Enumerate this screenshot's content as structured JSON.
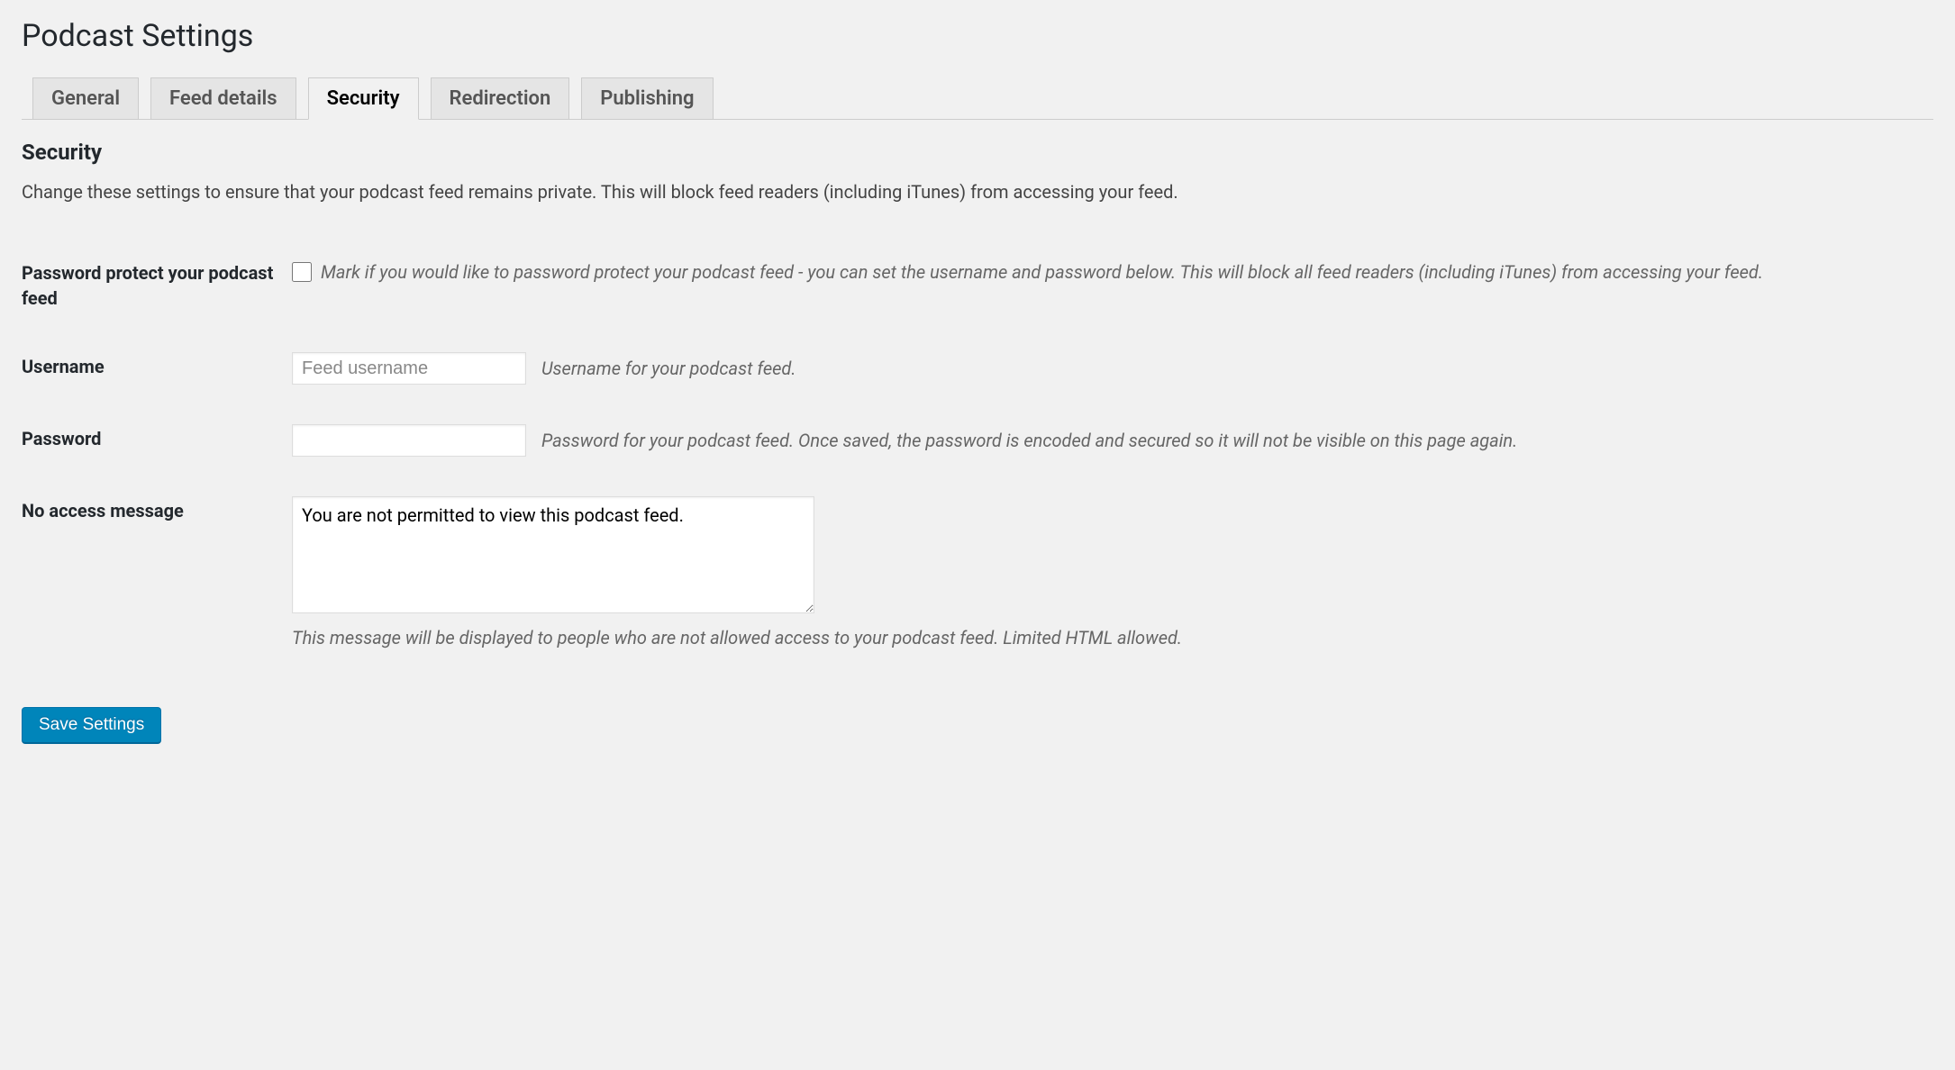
{
  "page_title": "Podcast Settings",
  "tabs": [
    {
      "label": "General",
      "active": false
    },
    {
      "label": "Feed details",
      "active": false
    },
    {
      "label": "Security",
      "active": true
    },
    {
      "label": "Redirection",
      "active": false
    },
    {
      "label": "Publishing",
      "active": false
    }
  ],
  "section": {
    "title": "Security",
    "description": "Change these settings to ensure that your podcast feed remains private. This will block feed readers (including iTunes) from accessing your feed."
  },
  "fields": {
    "protect": {
      "label": "Password protect your podcast feed",
      "checked": false,
      "help": "Mark if you would like to password protect your podcast feed - you can set the username and password below. This will block all feed readers (including iTunes) from accessing your feed."
    },
    "username": {
      "label": "Username",
      "value": "",
      "placeholder": "Feed username",
      "help": "Username for your podcast feed."
    },
    "password": {
      "label": "Password",
      "value": "",
      "help": "Password for your podcast feed. Once saved, the password is encoded and secured so it will not be visible on this page again."
    },
    "no_access": {
      "label": "No access message",
      "value": "You are not permitted to view this podcast feed.",
      "help": "This message will be displayed to people who are not allowed access to your podcast feed. Limited HTML allowed."
    }
  },
  "submit_label": "Save Settings"
}
